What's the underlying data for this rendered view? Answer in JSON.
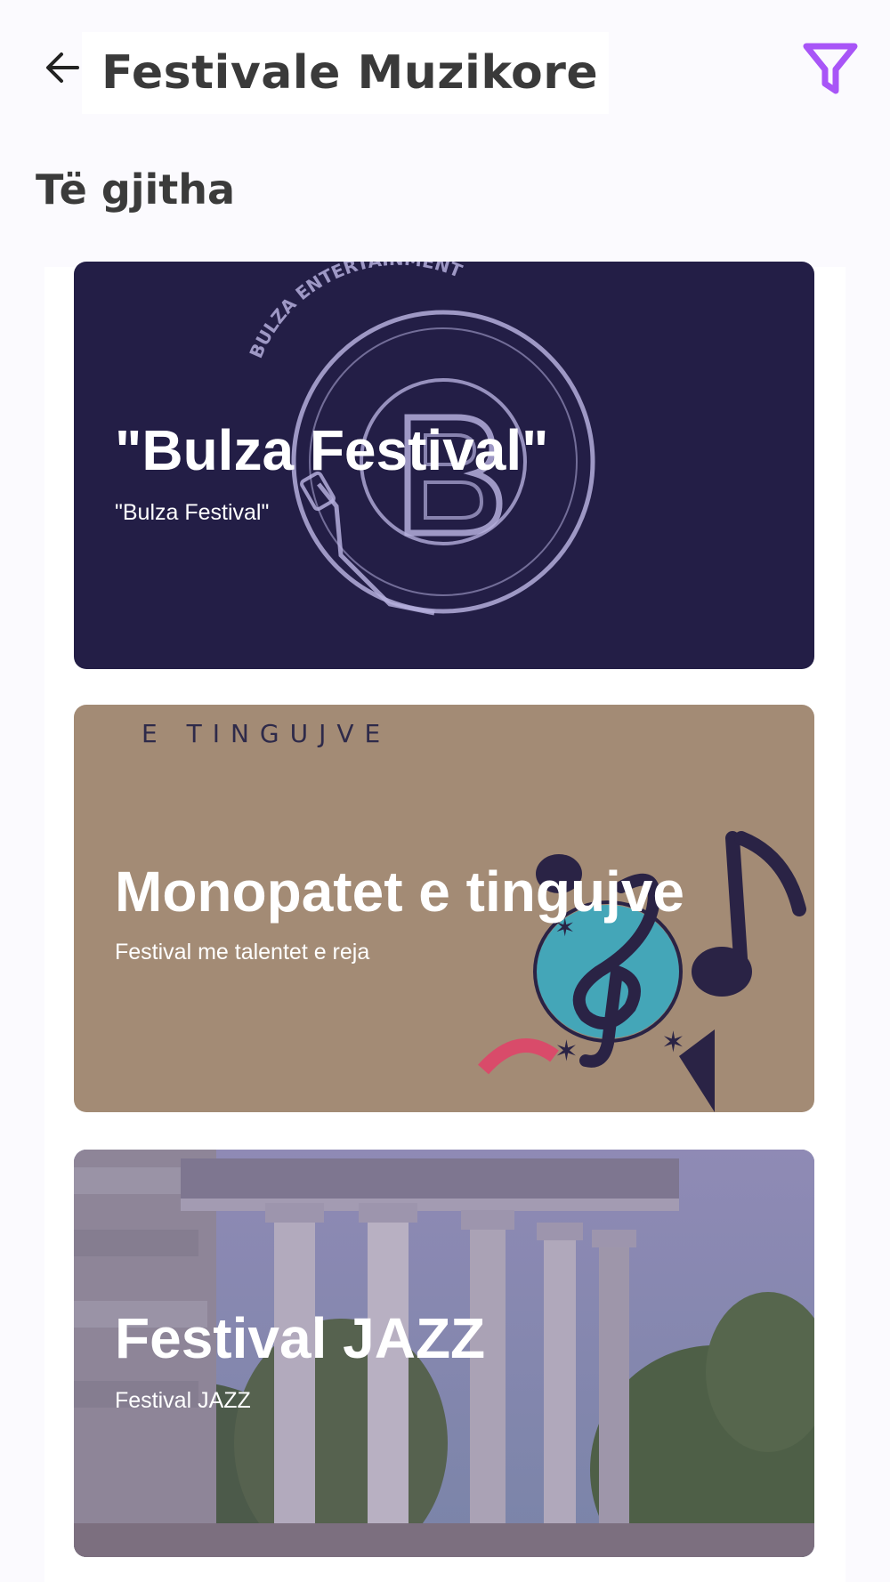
{
  "header": {
    "title": "Festivale Muzikore",
    "back_icon": "arrow-left-icon",
    "filter_icon": "filter-icon",
    "filter_color": "#a855f7"
  },
  "section": {
    "title": "Të gjitha"
  },
  "festivals": [
    {
      "title": "\"Bulza Festival\"",
      "subtitle": "\"Bulza Festival\"",
      "logo_text": "BULZA ENTERTAINMENT",
      "background": "#231e46"
    },
    {
      "title": "Monopatet e tingujve",
      "subtitle": "Festival me talentet e reja",
      "banner_text": "E TINGUJVE",
      "background": "#a38b75"
    },
    {
      "title": "Festival JAZZ",
      "subtitle": "Festival JAZZ",
      "background": "#6f6a8e"
    }
  ]
}
